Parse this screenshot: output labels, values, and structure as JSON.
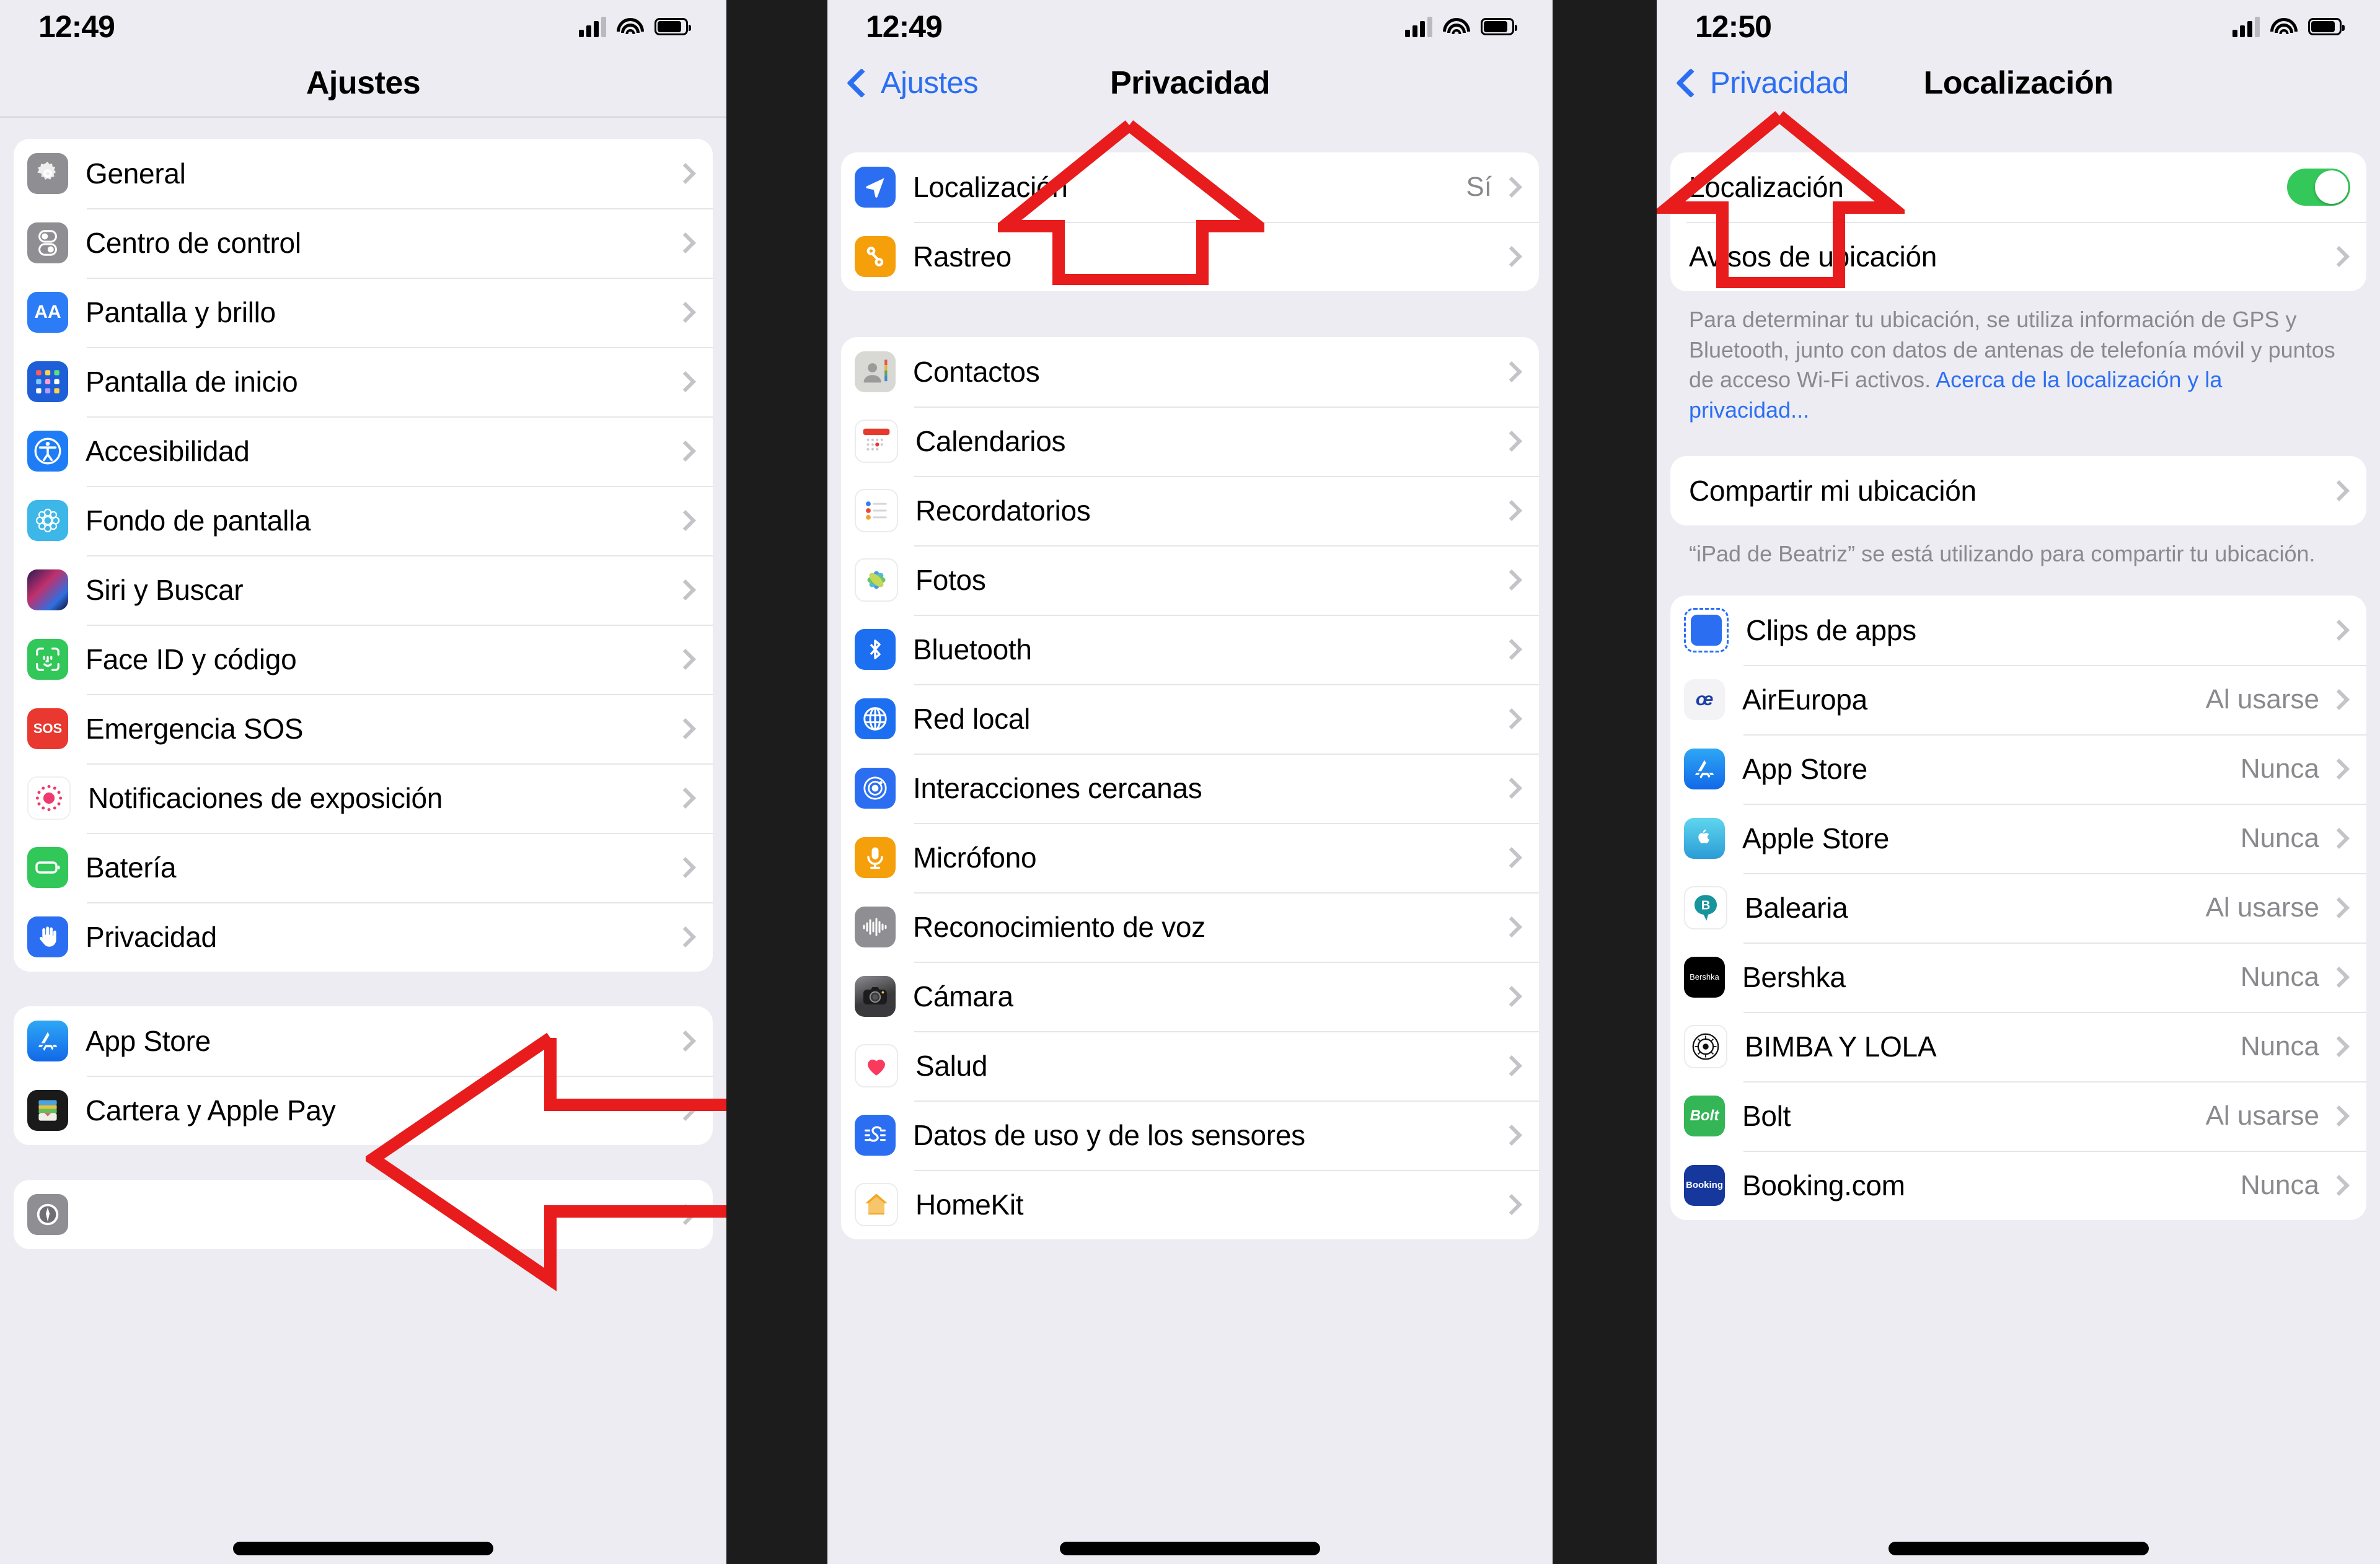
{
  "panels": [
    {
      "id": "ajustes",
      "status": {
        "time": "12:49",
        "signal_icon": "cellular-bars-icon",
        "wifi_icon": "wifi-icon",
        "battery_icon": "battery-icon"
      },
      "nav": {
        "title": "Ajustes",
        "back": null
      },
      "groups": [
        {
          "rows": [
            {
              "icon": "settings-gear-icon",
              "label": "General",
              "value": "",
              "chevron": true
            },
            {
              "icon": "control-center-icon",
              "label": "Centro de control",
              "value": "",
              "chevron": true
            },
            {
              "icon": "display-brightness-icon",
              "label": "Pantalla y brillo",
              "value": "",
              "chevron": true
            },
            {
              "icon": "home-screen-icon",
              "label": "Pantalla de inicio",
              "value": "",
              "chevron": true
            },
            {
              "icon": "accessibility-icon",
              "label": "Accesibilidad",
              "value": "",
              "chevron": true
            },
            {
              "icon": "wallpaper-icon",
              "label": "Fondo de pantalla",
              "value": "",
              "chevron": true
            },
            {
              "icon": "siri-icon",
              "label": "Siri y Buscar",
              "value": "",
              "chevron": true
            },
            {
              "icon": "face-id-icon",
              "label": "Face ID y código",
              "value": "",
              "chevron": true
            },
            {
              "icon": "sos-icon",
              "label": "Emergencia SOS",
              "value": "",
              "chevron": true
            },
            {
              "icon": "exposure-notifications-icon",
              "label": "Notificaciones de exposición",
              "value": "",
              "chevron": true
            },
            {
              "icon": "battery-icon",
              "label": "Batería",
              "value": "",
              "chevron": true
            },
            {
              "icon": "privacy-hand-icon",
              "label": "Privacidad",
              "value": "",
              "chevron": true
            }
          ]
        },
        {
          "rows": [
            {
              "icon": "app-store-icon",
              "label": "App Store",
              "value": "",
              "chevron": true
            },
            {
              "icon": "wallet-icon",
              "label": "Cartera y Apple Pay",
              "value": "",
              "chevron": true
            }
          ]
        },
        {
          "rows": [
            {
              "icon": "compass-icon",
              "label": "",
              "value": "",
              "chevron": true
            }
          ]
        }
      ]
    },
    {
      "id": "privacidad",
      "status": {
        "time": "12:49",
        "signal_icon": "cellular-bars-icon",
        "wifi_icon": "wifi-icon",
        "battery_icon": "battery-icon"
      },
      "nav": {
        "title": "Privacidad",
        "back": "Ajustes"
      },
      "groups": [
        {
          "rows": [
            {
              "icon": "location-arrow-icon",
              "label": "Localización",
              "value": "Sí",
              "chevron": true
            },
            {
              "icon": "tracking-icon",
              "label": "Rastreo",
              "value": "",
              "chevron": true
            }
          ]
        },
        {
          "rows": [
            {
              "icon": "contacts-icon",
              "label": "Contactos",
              "value": "",
              "chevron": true
            },
            {
              "icon": "calendar-icon",
              "label": "Calendarios",
              "value": "",
              "chevron": true
            },
            {
              "icon": "reminders-icon",
              "label": "Recordatorios",
              "value": "",
              "chevron": true
            },
            {
              "icon": "photos-icon",
              "label": "Fotos",
              "value": "",
              "chevron": true
            },
            {
              "icon": "bluetooth-icon",
              "label": "Bluetooth",
              "value": "",
              "chevron": true
            },
            {
              "icon": "local-network-icon",
              "label": "Red local",
              "value": "",
              "chevron": true
            },
            {
              "icon": "nearby-interactions-icon",
              "label": "Interacciones cercanas",
              "value": "",
              "chevron": true
            },
            {
              "icon": "microphone-icon",
              "label": "Micrófono",
              "value": "",
              "chevron": true
            },
            {
              "icon": "speech-recognition-icon",
              "label": "Reconocimiento de voz",
              "value": "",
              "chevron": true
            },
            {
              "icon": "camera-icon",
              "label": "Cámara",
              "value": "",
              "chevron": true
            },
            {
              "icon": "health-icon",
              "label": "Salud",
              "value": "",
              "chevron": true
            },
            {
              "icon": "sensor-data-icon",
              "label": "Datos de uso y de los sensores",
              "value": "",
              "chevron": true
            },
            {
              "icon": "homekit-icon",
              "label": "HomeKit",
              "value": "",
              "chevron": true
            }
          ]
        }
      ]
    },
    {
      "id": "localizacion",
      "status": {
        "time": "12:50",
        "signal_icon": "cellular-bars-icon",
        "wifi_icon": "wifi-icon",
        "battery_icon": "battery-icon"
      },
      "nav": {
        "title": "Localización",
        "back": "Privacidad"
      },
      "toggle_row": {
        "label": "Localización",
        "toggle_on": true,
        "toggle_color": "#34c759"
      },
      "alerts_row": {
        "label": "Avisos de ubicación",
        "chevron": true
      },
      "description": "Para determinar tu ubicación, se utiliza información de GPS y Bluetooth, junto con datos de antenas de telefonía móvil y puntos de acceso Wi-Fi activos.",
      "description_link": "Acerca de la localización y la privacidad...",
      "share_row": {
        "label": "Compartir mi ubicación",
        "chevron": true
      },
      "share_footnote": "“iPad de Beatriz” se está utilizando para compartir tu ubicación.",
      "apps": [
        {
          "icon": "app-clips-icon",
          "label": "Clips de apps",
          "value": "",
          "chevron": true
        },
        {
          "icon": "aireuropa-icon",
          "label": "AirEuropa",
          "value": "Al usarse",
          "chevron": true
        },
        {
          "icon": "app-store-icon",
          "label": "App Store",
          "value": "Nunca",
          "chevron": true
        },
        {
          "icon": "apple-store-icon",
          "label": "Apple Store",
          "value": "Nunca",
          "chevron": true
        },
        {
          "icon": "balearia-icon",
          "label": "Balearia",
          "value": "Al usarse",
          "chevron": true
        },
        {
          "icon": "bershka-icon",
          "label": "Bershka",
          "value": "Nunca",
          "chevron": true
        },
        {
          "icon": "bimba-y-lola-icon",
          "label": "BIMBA Y LOLA",
          "value": "Nunca",
          "chevron": true
        },
        {
          "icon": "bolt-icon",
          "label": "Bolt",
          "value": "Al usarse",
          "chevron": true
        },
        {
          "icon": "booking-icon",
          "label": "Booking.com",
          "value": "Nunca",
          "chevron": true
        }
      ]
    }
  ],
  "annotations": {
    "arrow_color": "#e81c1c",
    "arrow_left_target": "Privacidad",
    "arrow_up_middle_target": "Localización",
    "arrow_up_right_target": "Localización"
  },
  "icon_text": {
    "aa": "AA",
    "sos": "SOS",
    "aireuropa": "œ",
    "bershka": "Bershka",
    "bolt": "Bolt",
    "booking": "Booking",
    "balearia": "B"
  }
}
